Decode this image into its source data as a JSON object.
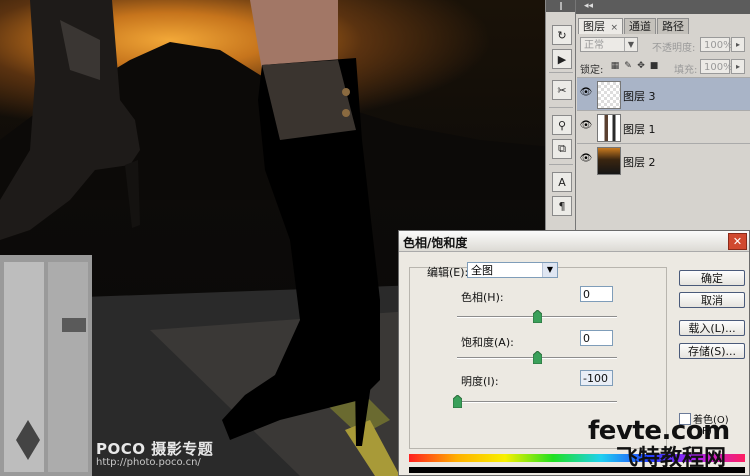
{
  "watermark": {
    "poco_brand": "POCO 摄影专题",
    "poco_url": "http://photo.poco.cn/",
    "fevte_brand": "fevte.com",
    "fevte_cn": "飞特教程网"
  },
  "layers_panel": {
    "tabs": [
      {
        "label": "图层",
        "close": "×"
      },
      {
        "label": "通道"
      },
      {
        "label": "路径"
      }
    ],
    "blend_mode": "正常",
    "opacity_label": "不透明度:",
    "opacity_value": "100%",
    "lock_label": "锁定:",
    "fill_label": "填充:",
    "fill_value": "100%",
    "layers": [
      {
        "name": "图层 3",
        "selected": true
      },
      {
        "name": "图层 1",
        "selected": false
      },
      {
        "name": "图层 2",
        "selected": false
      }
    ]
  },
  "dialog": {
    "title": "色相/饱和度",
    "edit_label": "编辑(E):",
    "edit_value": "全图",
    "hue_label": "色相(H):",
    "hue_value": "0",
    "saturation_label": "饱和度(A):",
    "saturation_value": "0",
    "lightness_label": "明度(I):",
    "lightness_value": "-100",
    "hue_level": 0.5,
    "saturation_level": 0.5,
    "lightness_level": 0.0,
    "buttons": {
      "ok": "确定",
      "cancel": "取消",
      "load": "载入(L)...",
      "save": "存储(S)..."
    },
    "colorize_label": "着色(O)",
    "preview_label": "P)"
  }
}
